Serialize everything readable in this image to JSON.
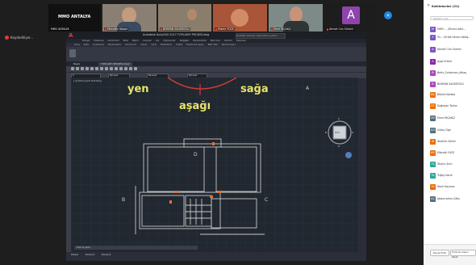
{
  "meeting": {
    "recording_label": "Kaydediliyor...",
    "share_badge": "»"
  },
  "tiles": [
    {
      "name": "MMO ANTALYA",
      "mic": false
    },
    {
      "name": "Fahrettin Nazeri",
      "mic": true
    },
    {
      "name": "BÜNYAN SALİMOĞLU",
      "mic": true
    },
    {
      "name": "Erdem YÜCE",
      "mic": true
    },
    {
      "name": "Emre BIÇAKÇI",
      "mic": true
    },
    {
      "name": "Ahmet Can Sümeli",
      "mic": true
    }
  ],
  "center_tile_name": "MMO ANTALYA",
  "avatar_letter": "A",
  "autocad": {
    "title": "Autodesk AutoCAD 2017   TOPLANTI PROJESİ.dwg",
    "search_placeholder": "Anahtar sözcük veya tümce yazın",
    "menu": [
      "Dosya",
      "Düzenle",
      "Görünüm",
      "Ekle",
      "Biçim",
      "Araçlar",
      "Çiz",
      "Ölçülendir",
      "Değiştir",
      "Parametrik",
      "Pencere",
      "Yardım",
      "Express"
    ],
    "ribbon_tabs": [
      "Giriş",
      "Ekle",
      "Açıklama",
      "Parametrik",
      "Görünüm",
      "Yönet",
      "Çıktı",
      "Eklentiler",
      "A360",
      "Featured Apps",
      "BIM 360",
      "Performans"
    ],
    "doc_tabs": [
      "Başla",
      "TOPLANTI PROJESİ.dwg*"
    ],
    "layer_combo": "0",
    "by_layer_1": "ByLayer",
    "by_layer_2": "ByLayer",
    "by_layer_3": "ByLayer",
    "viewport_label": "[-][Üstten][2D Telkafes]",
    "annotations": {
      "left": "yen",
      "down": "aşağı",
      "right": "sağa"
    },
    "points": {
      "A_top": "A",
      "D": "D",
      "B": "B",
      "C": "C",
      "A_bottom": "A"
    },
    "compass": {
      "N": "K",
      "S": "G",
      "E": "D",
      "W": "B",
      "center": "ÜST"
    },
    "command_placeholder": "Komut yazın",
    "layout_tabs": [
      "Model",
      "Düzen1",
      "Düzen2"
    ]
  },
  "panel": {
    "title": "Katılımcılar (21)",
    "search_placeholder": "Katılımcı bul",
    "participants": [
      {
        "name": "MMO ... (Ekranı bölü...",
        "color": "#7e57c2",
        "letter": "M"
      },
      {
        "name": "Yü... (Ortak ekranı bölüş...",
        "color": "#7e57c2",
        "letter": "Y"
      },
      {
        "name": "Ahmet Can Sümeli",
        "color": "#7e57c2",
        "letter": "A"
      },
      {
        "name": "Ayşe Ertürk",
        "color": "#8e24aa",
        "letter": "A"
      },
      {
        "name": "Bekir_Suleyman_Aktaş",
        "color": "#ab47bc",
        "letter": "B"
      },
      {
        "name": "BÜNYAN SALİMOĞLU",
        "color": "#ab47bc",
        "letter": "B"
      },
      {
        "name": "Bülent Kalaba",
        "color": "#ef6c00",
        "letter": "BK"
      },
      {
        "name": "Doğukan Tarlan",
        "color": "#ef6c00",
        "letter": "DT"
      },
      {
        "name": "Emre BIÇAKÇI",
        "color": "#546e7a",
        "letter": "EB"
      },
      {
        "name": "Gülay Öge",
        "color": "#546e7a",
        "letter": "GÖ"
      },
      {
        "name": "İbrahim Demir",
        "color": "#ef6c00",
        "letter": "İD"
      },
      {
        "name": "Mikrofo YÜCE",
        "color": "#ef6c00",
        "letter": "MY"
      },
      {
        "name": "Tayfun Şirin",
        "color": "#26a69a",
        "letter": "TŞ"
      },
      {
        "name": "Tuğay Karar",
        "color": "#26a69a",
        "letter": "TK"
      },
      {
        "name": "Yasin Kaçmaz",
        "color": "#ef6c00",
        "letter": "YK"
      },
      {
        "name": "Abdurrahim Çiftçi",
        "color": "#546e7a",
        "letter": "AÇ"
      }
    ],
    "invite_button": "Davet Edin",
    "mute_all_button": "Tümünün Sesini Kapat"
  }
}
